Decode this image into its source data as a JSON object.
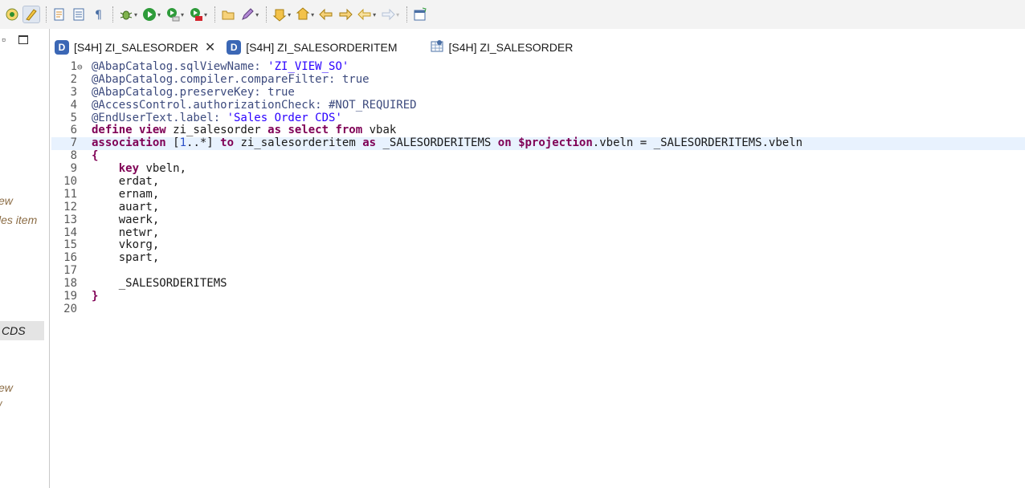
{
  "toolbar": {
    "icons": [
      "new-connection-icon",
      "highlight-icon",
      "open-object-icon",
      "outline-icon",
      "show-whitespace-icon",
      "debug-icon",
      "run-icon",
      "coverage-icon",
      "external-tools-icon",
      "open-folder-icon",
      "pen-icon",
      "next-annotation-icon",
      "prev-annotation-icon",
      "back-edit-icon",
      "forward-edit-icon",
      "back-icon",
      "forward-icon",
      "new-window-icon"
    ]
  },
  "left_panel": {
    "texts": [
      "ew",
      "les item",
      "CDS",
      "ew",
      "/"
    ]
  },
  "tabs": [
    {
      "label": "[S4H] ZI_SALESORDER",
      "close": "✕",
      "icon": "ddl-icon"
    },
    {
      "label": "[S4H] ZI_SALESORDERITEM",
      "icon": "ddl-icon"
    },
    {
      "label": "[S4H] ZI_SALESORDER",
      "icon": "data-preview-icon"
    }
  ],
  "editor": {
    "line_numbers": [
      "1",
      "2",
      "3",
      "4",
      "5",
      "6",
      "7",
      "8",
      "9",
      "10",
      "11",
      "12",
      "13",
      "14",
      "15",
      "16",
      "17",
      "18",
      "19",
      "20"
    ],
    "current_line": 7,
    "lines": [
      [
        {
          "t": "@AbapCatalog.sqlViewName: ",
          "c": "ann"
        },
        {
          "t": "'ZI_VIEW_SO'",
          "c": "str"
        }
      ],
      [
        {
          "t": "@AbapCatalog.compiler.compareFilter: true",
          "c": "ann"
        }
      ],
      [
        {
          "t": "@AbapCatalog.preserveKey: true",
          "c": "ann"
        }
      ],
      [
        {
          "t": "@AccessControl.authorizationCheck: #NOT_REQUIRED",
          "c": "ann"
        }
      ],
      [
        {
          "t": "@EndUserText.label: ",
          "c": "ann"
        },
        {
          "t": "'Sales Order CDS'",
          "c": "str"
        }
      ],
      [
        {
          "t": "define view",
          "c": "kw"
        },
        {
          "t": " zi_salesorder ",
          "c": ""
        },
        {
          "t": "as select from",
          "c": "kw"
        },
        {
          "t": " vbak",
          "c": ""
        }
      ],
      [
        {
          "t": "association",
          "c": "kw"
        },
        {
          "t": " [",
          "c": ""
        },
        {
          "t": "1",
          "c": "num"
        },
        {
          "t": "..*] ",
          "c": ""
        },
        {
          "t": "to",
          "c": "kw"
        },
        {
          "t": " zi_salesorderitem ",
          "c": ""
        },
        {
          "t": "as",
          "c": "kw"
        },
        {
          "t": " _SALESORDERITEMS ",
          "c": ""
        },
        {
          "t": "on",
          "c": "kw"
        },
        {
          "t": " ",
          "c": ""
        },
        {
          "t": "$projection",
          "c": "kw"
        },
        {
          "t": ".vbeln = _SALESORDERITEMS.vbeln",
          "c": ""
        }
      ],
      [
        {
          "t": "{",
          "c": "kw"
        }
      ],
      [
        {
          "t": "    ",
          "c": ""
        },
        {
          "t": "key",
          "c": "kw"
        },
        {
          "t": " vbeln,",
          "c": ""
        }
      ],
      [
        {
          "t": "    erdat,",
          "c": ""
        }
      ],
      [
        {
          "t": "    ernam,",
          "c": ""
        }
      ],
      [
        {
          "t": "    auart,",
          "c": ""
        }
      ],
      [
        {
          "t": "    waerk,",
          "c": ""
        }
      ],
      [
        {
          "t": "    netwr,",
          "c": ""
        }
      ],
      [
        {
          "t": "    vkorg,",
          "c": ""
        }
      ],
      [
        {
          "t": "    spart,",
          "c": ""
        }
      ],
      [
        {
          "t": "",
          "c": ""
        }
      ],
      [
        {
          "t": "    _SALESORDERITEMS",
          "c": ""
        }
      ],
      [
        {
          "t": "}",
          "c": "kw"
        }
      ],
      [
        {
          "t": "",
          "c": ""
        }
      ]
    ]
  }
}
